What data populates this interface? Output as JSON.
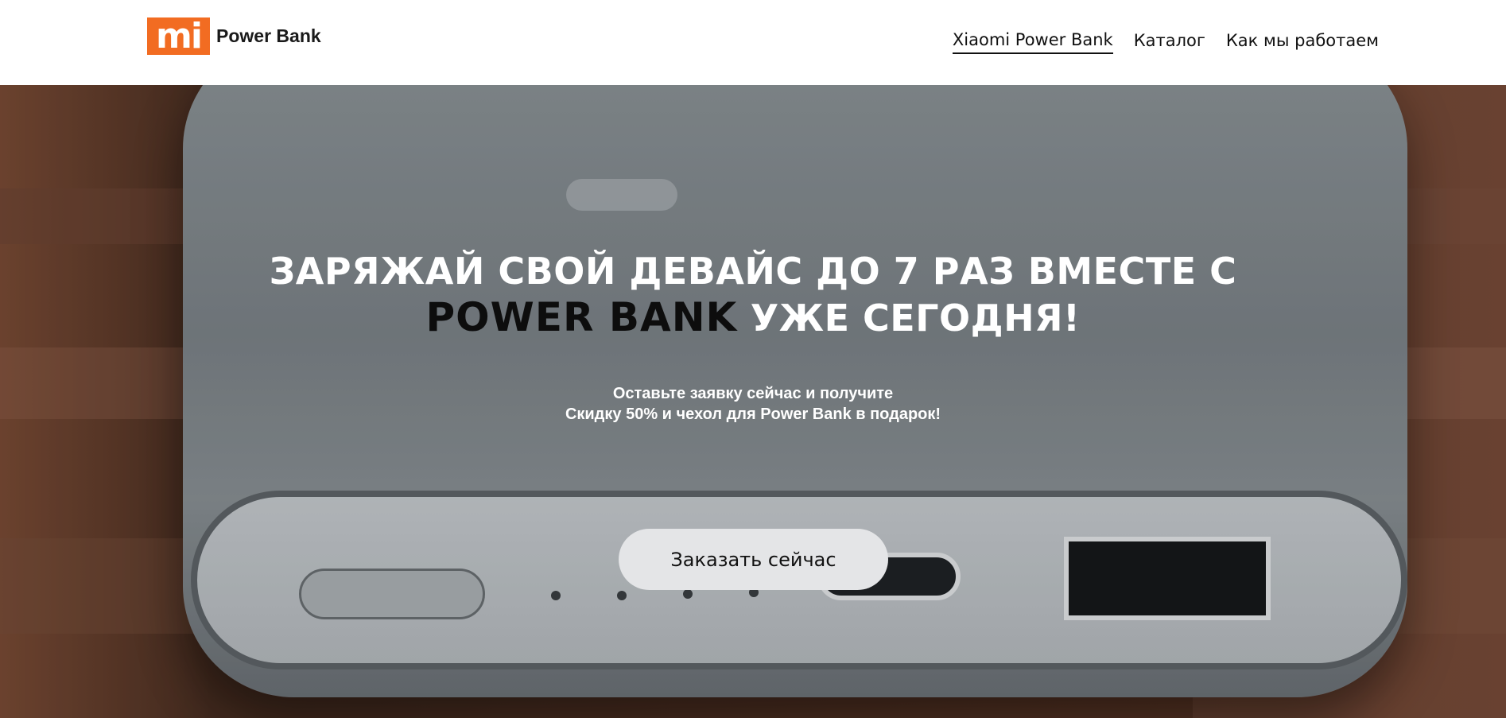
{
  "header": {
    "logo_mark": "mi",
    "logo_text": "Power Bank",
    "nav": [
      {
        "label": "Xiaomi Power Bank",
        "active": true
      },
      {
        "label": "Каталог",
        "active": false
      },
      {
        "label": "Как мы работаем",
        "active": false
      }
    ]
  },
  "hero": {
    "headline_line1": "ЗАРЯЖАЙ СВОЙ ДЕВАЙС ДО 7 РАЗ ВМЕСТЕ С",
    "headline_brand": "POWER BANK",
    "headline_line2_rest": " УЖЕ СЕГОДНЯ!",
    "subtext_line1": "Оставьте заявку сейчас и получите",
    "subtext_line2": "Скидку 50% и чехол для Power Bank в подарок!",
    "cta_label": "Заказать сейчас"
  },
  "colors": {
    "brand_orange": "#f26c22",
    "cta_background": "#e4e5e7",
    "header_background": "#ffffff"
  },
  "icons": {
    "logo": "mi-logo-icon"
  }
}
